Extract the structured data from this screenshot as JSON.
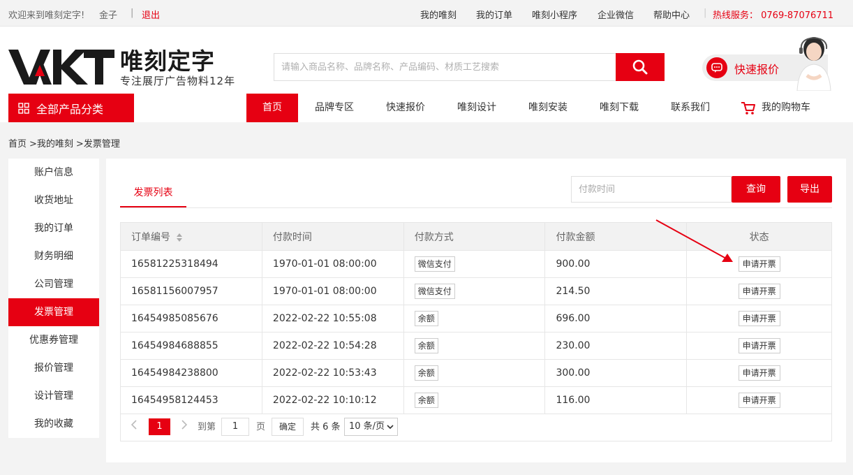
{
  "topbar": {
    "welcome": "欢迎来到唯刻定字!",
    "username": "金子",
    "separator": "|",
    "logout": "退出",
    "links": [
      "我的唯刻",
      "我的订单",
      "唯刻小程序",
      "企业微信",
      "帮助中心"
    ],
    "divider": "|",
    "hotline": "热线服务：  0769-87076711"
  },
  "header": {
    "brand_cn": "唯刻定字",
    "slogan": "专注展厅广告物料12年",
    "search_placeholder": "请输入商品名称、品牌名称、产品编码、材质工艺搜索",
    "quick_quote": "快速报价"
  },
  "nav": {
    "all_categories": "全部产品分类",
    "items": [
      "首页",
      "品牌专区",
      "快速报价",
      "唯刻设计",
      "唯刻安装",
      "唯刻下载",
      "联系我们",
      "我的购物车"
    ]
  },
  "breadcrumb": [
    "首页",
    ">我的唯刻",
    ">发票管理"
  ],
  "sidebar": {
    "items": [
      "账户信息",
      "收货地址",
      "我的订单",
      "财务明细",
      "公司管理",
      "发票管理",
      "优惠券管理",
      "报价管理",
      "设计管理",
      "我的收藏"
    ],
    "active": "发票管理"
  },
  "main": {
    "tab": "发票列表",
    "date_placeholder": "付款时间",
    "query_btn": "查询",
    "export_btn": "导出",
    "columns": [
      "订单编号",
      "付款时间",
      "付款方式",
      "付款金额",
      "状态"
    ],
    "rows": [
      {
        "order": "16581225318494",
        "time": "1970-01-01 08:00:00",
        "method": "微信支付",
        "amount": "900.00",
        "status": "申请开票"
      },
      {
        "order": "16581156007957",
        "time": "1970-01-01 08:00:00",
        "method": "微信支付",
        "amount": "214.50",
        "status": "申请开票"
      },
      {
        "order": "16454985085676",
        "time": "2022-02-22 10:55:08",
        "method": "余额",
        "amount": "696.00",
        "status": "申请开票"
      },
      {
        "order": "16454984688855",
        "time": "2022-02-22 10:54:28",
        "method": "余额",
        "amount": "230.00",
        "status": "申请开票"
      },
      {
        "order": "16454984238800",
        "time": "2022-02-22 10:53:43",
        "method": "余额",
        "amount": "300.00",
        "status": "申请开票"
      },
      {
        "order": "16454958124453",
        "time": "2022-02-22 10:10:12",
        "method": "余额",
        "amount": "116.00",
        "status": "申请开票"
      }
    ],
    "pagination": {
      "current": "1",
      "goto_label": "到第",
      "goto_value": "1",
      "page_label": "页",
      "confirm": "确定",
      "total": "共 6 条",
      "per_page": "10 条/页"
    }
  },
  "colors": {
    "accent": "#e60012",
    "bg": "#f3f3f3"
  }
}
